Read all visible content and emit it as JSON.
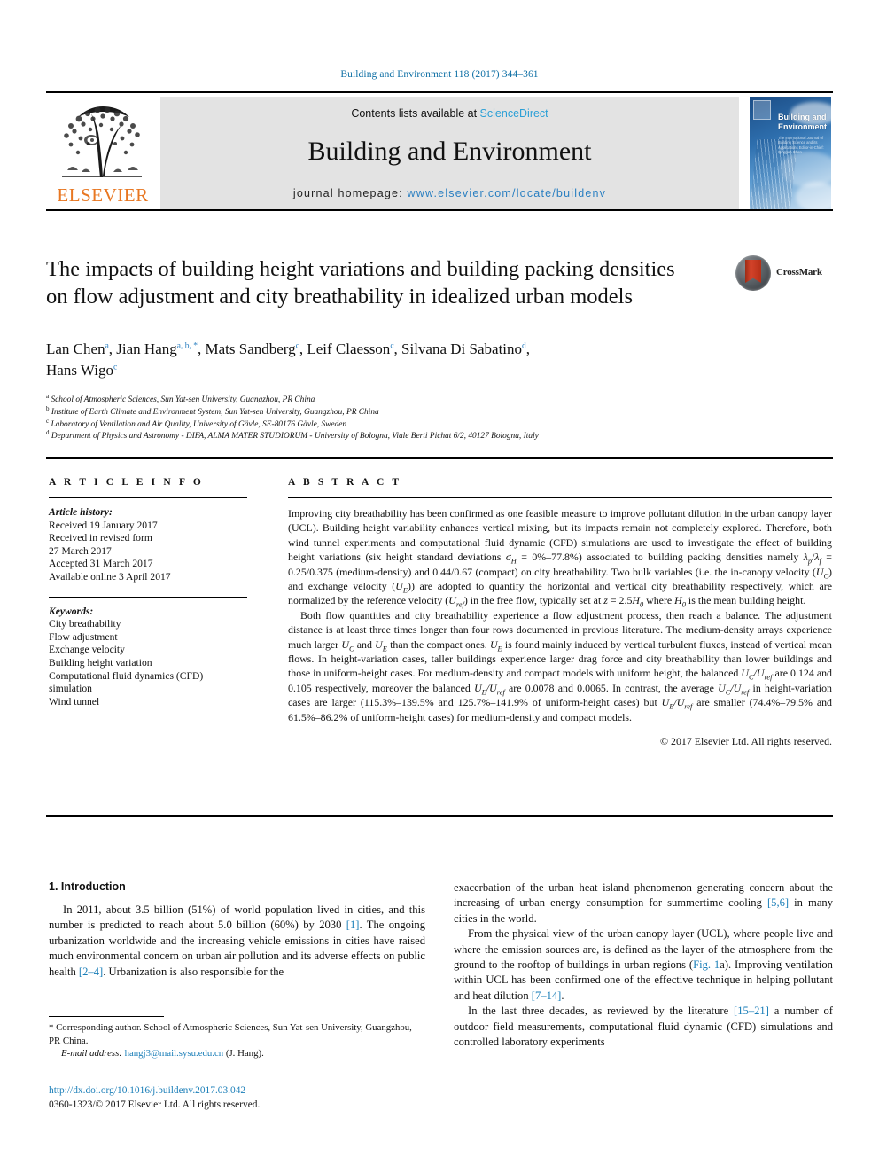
{
  "running_head": "Building and Environment 118 (2017) 344–361",
  "masthead": {
    "publisher_logo_text": "ELSEVIER",
    "contents_prefix": "Contents lists available at ",
    "contents_link": "ScienceDirect",
    "journal_name": "Building and Environment",
    "homepage_prefix": "journal homepage: ",
    "homepage_url": "www.elsevier.com/locate/buildenv",
    "cover_title_line1": "Building and",
    "cover_title_line2": "Environment",
    "cover_subtitle": "The International Journal of Building Science and its Applications Editor-in-Chief: Qingyan Chen"
  },
  "article": {
    "title": "The impacts of building height variations and building packing densities on flow adjustment and city breathability in idealized urban models",
    "crossmark_label": "CrossMark",
    "authors_line1_parts": [
      {
        "name": "Lan Chen",
        "sup": "a"
      },
      {
        "name": "Jian Hang",
        "sup": "a, b, *"
      },
      {
        "name": "Mats Sandberg",
        "sup": "c"
      },
      {
        "name": "Leif Claesson",
        "sup": "c"
      },
      {
        "name": "Silvana Di Sabatino",
        "sup": "d"
      }
    ],
    "authors_line2_parts": [
      {
        "name": "Hans Wigo",
        "sup": "c"
      }
    ],
    "affiliations": [
      {
        "sup": "a",
        "text": "School of Atmospheric Sciences, Sun Yat-sen University, Guangzhou, PR China"
      },
      {
        "sup": "b",
        "text": "Institute of Earth Climate and Environment System, Sun Yat-sen University, Guangzhou, PR China"
      },
      {
        "sup": "c",
        "text": "Laboratory of Ventilation and Air Quality, University of Gävle, SE-80176 Gävle, Sweden"
      },
      {
        "sup": "d",
        "text": "Department of Physics and Astronomy - DIFA, ALMA MATER STUDIORUM - University of Bologna, Viale Berti Pichat 6/2, 40127 Bologna, Italy"
      }
    ]
  },
  "article_info": {
    "heading": "A R T I C L E   I N F O",
    "history_label": "Article history:",
    "history": [
      "Received 19 January 2017",
      "Received in revised form",
      "27 March 2017",
      "Accepted 31 March 2017",
      "Available online 3 April 2017"
    ],
    "keywords_label": "Keywords:",
    "keywords": [
      "City breathability",
      "Flow adjustment",
      "Exchange velocity",
      "Building height variation",
      "Computational fluid dynamics (CFD)",
      "simulation",
      "Wind tunnel"
    ]
  },
  "abstract": {
    "heading": "A B S T R A C T",
    "paragraph1_a": "Improving city breathability has been confirmed as one feasible measure to improve pollutant dilution in the urban canopy layer (UCL). Building height variability enhances vertical mixing, but its impacts remain not completely explored. Therefore, both wind tunnel experiments and computational fluid dynamic (CFD) simulations are used to investigate the effect of building height variations (six height standard deviations ",
    "sigma_symbol": "σ",
    "sigma_sub": "H",
    "paragraph1_b": " = 0%–77.8%) associated to building packing densities namely ",
    "lambda_p": "λ",
    "lambda_p_sub": "p",
    "lambda_f": "λ",
    "lambda_f_sub": "f",
    "paragraph1_c": " = 0.25/0.375 (medium-density) and 0.44/0.67 (compact) on city breathability. Two bulk variables (i.e. the in-canopy velocity (",
    "uc": "U",
    "uc_sub": "C",
    "paragraph1_d": ") and exchange velocity (",
    "ue": "U",
    "ue_sub": "E",
    "paragraph1_e": ")) are adopted to quantify the horizontal and vertical city breathability respectively, which are normalized by the reference velocity (",
    "uref": "U",
    "uref_sub": "ref",
    "paragraph1_f": ") in the free flow, typically set at ",
    "z_eq": "z",
    "paragraph1_g": " = 2.5",
    "h0": "H",
    "h0_sub": "0",
    "paragraph1_h": " where ",
    "paragraph1_i": " is the mean building height.",
    "paragraph2_a": "Both flow quantities and city breathability experience a flow adjustment process, then reach a balance. The adjustment distance is at least three times longer than four rows documented in previous literature. The medium-density arrays experience much larger ",
    "paragraph2_b": " and ",
    "paragraph2_c": " than the compact ones. ",
    "paragraph2_d": " is found mainly induced by vertical turbulent fluxes, instead of vertical mean flows. In height-variation cases, taller buildings experience larger drag force and city breathability than lower buildings and those in uniform-height cases. For medium-density and compact models with uniform height, the balanced ",
    "paragraph2_e": " are 0.124 and 0.105 respectively, moreover the balanced ",
    "paragraph2_f": " are 0.0078 and 0.0065. In contrast, the average ",
    "paragraph2_g": " in height-variation cases are larger (115.3%–139.5% and 125.7%–141.9% of uniform-height cases) but ",
    "paragraph2_h": " are smaller (74.4%–79.5% and 61.5%–86.2% of uniform-height cases) for medium-density and compact models.",
    "copyright": "© 2017 Elsevier Ltd. All rights reserved."
  },
  "body": {
    "section_number_title": "1.  Introduction",
    "left_p1_a": "In 2011, about 3.5 billion (51%) of world population lived in cities, and this number is predicted to reach about 5.0 billion (60%) by 2030 ",
    "left_ref1": "[1]",
    "left_p1_b": ". The ongoing urbanization worldwide and the increasing vehicle emissions in cities have raised much environmental concern on urban air pollution and its adverse effects on public health ",
    "left_ref2": "[2–4]",
    "left_p1_c": ". Urbanization is also responsible for the",
    "right_p1_a": "exacerbation of the urban heat island phenomenon generating concern about the increasing of urban energy consumption for summertime cooling ",
    "right_ref1": "[5,6]",
    "right_p1_b": " in many cities in the world.",
    "right_p2_a": "From the physical view of the urban canopy layer (UCL), where people live and where the emission sources are, is defined as the layer of the atmosphere from the ground to the rooftop of buildings in urban regions (",
    "right_ref2": "Fig. 1",
    "right_p2_b": "a). Improving ventilation within UCL has been confirmed one of the effective technique in helping pollutant and heat dilution ",
    "right_ref3": "[7–14]",
    "right_p2_c": ".",
    "right_p3_a": "In the last three decades, as reviewed by the literature ",
    "right_ref4": "[15–21]",
    "right_p3_b": " a number of outdoor field measurements, computational fluid dynamic (CFD) simulations and controlled laboratory experiments"
  },
  "footer": {
    "corresponding_marker": "*",
    "corresponding_text": " Corresponding author. School of Atmospheric Sciences, Sun Yat-sen University, Guangzhou, PR China.",
    "email_label": "E-mail address:",
    "email_address": "hangj3@mail.sysu.edu.cn",
    "email_suffix": " (J. Hang).",
    "doi_url": "http://dx.doi.org/10.1016/j.buildenv.2017.03.042",
    "issn_line": "0360-1323/© 2017 Elsevier Ltd. All rights reserved."
  },
  "colors": {
    "link_blue": "#1a7eb8",
    "sciencedirect_blue": "#2a9fd6",
    "elsevier_orange": "#E87722",
    "masthead_grey": "#e3e3e3"
  }
}
